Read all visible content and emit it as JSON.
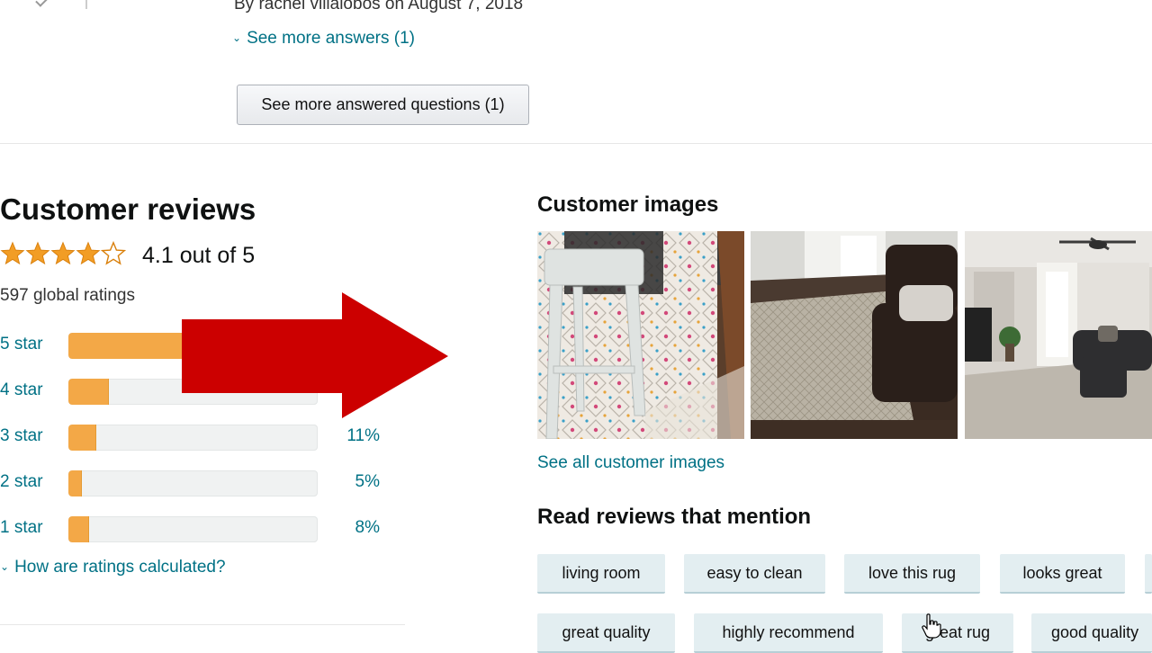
{
  "qa": {
    "byline": "By rachel villalobos on August 7, 2018",
    "see_more_answers": "See more answers (1)",
    "see_more_questions_button": "See more answered questions (1)"
  },
  "reviews": {
    "title": "Customer reviews",
    "rating_stars": 4.1,
    "avg_text": "4.1 out of 5",
    "global_ratings": "597 global ratings",
    "breakdown": [
      {
        "label": "5 star",
        "percent_text": "",
        "fraction": 0.63
      },
      {
        "label": "4 star",
        "percent_text": "",
        "fraction": 0.16
      },
      {
        "label": "3 star",
        "percent_text": "11%",
        "fraction": 0.11
      },
      {
        "label": "2 star",
        "percent_text": "5%",
        "fraction": 0.05
      },
      {
        "label": "1 star",
        "percent_text": "8%",
        "fraction": 0.08
      }
    ],
    "how_calculated": "How are ratings calculated?"
  },
  "images": {
    "title": "Customer images",
    "see_all": "See all customer images"
  },
  "mentions": {
    "title": "Read reviews that mention",
    "row1": [
      "living room",
      "easy to clean",
      "love this rug",
      "looks great"
    ],
    "row2": [
      "great quality",
      "highly recommend",
      "great rug",
      "good quality"
    ]
  },
  "colors": {
    "link": "#007185",
    "bar_fill": "#f3a847",
    "bar_track": "#f0f2f2",
    "tag_bg": "#e3eef1",
    "arrow_red": "#cc0000",
    "star": "#f29d25"
  }
}
